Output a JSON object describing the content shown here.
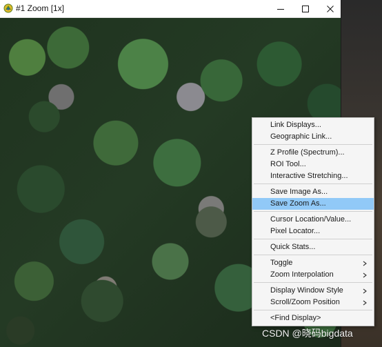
{
  "window": {
    "title": "#1 Zoom [1x]",
    "icons": {
      "app": "app-icon",
      "minimize": "minimize-icon",
      "maximize": "maximize-icon",
      "close": "close-icon"
    }
  },
  "image": {
    "description_role": "aerial-forest-canopy"
  },
  "context_menu": {
    "items": [
      {
        "label": "Link Displays...",
        "has_submenu": false
      },
      {
        "label": "Geographic Link...",
        "has_submenu": false
      },
      {
        "separator": true
      },
      {
        "label": "Z Profile (Spectrum)...",
        "has_submenu": false
      },
      {
        "label": "ROI Tool...",
        "has_submenu": false
      },
      {
        "label": "Interactive Stretching...",
        "has_submenu": false
      },
      {
        "separator": true
      },
      {
        "label": "Save Image As...",
        "has_submenu": false
      },
      {
        "label": "Save Zoom As...",
        "has_submenu": false,
        "highlighted": true
      },
      {
        "separator": true
      },
      {
        "label": "Cursor Location/Value...",
        "has_submenu": false
      },
      {
        "label": "Pixel Locator...",
        "has_submenu": false
      },
      {
        "separator": true
      },
      {
        "label": "Quick Stats...",
        "has_submenu": false
      },
      {
        "separator": true
      },
      {
        "label": "Toggle",
        "has_submenu": true
      },
      {
        "label": "Zoom Interpolation",
        "has_submenu": true
      },
      {
        "separator": true
      },
      {
        "label": "Display Window Style",
        "has_submenu": true
      },
      {
        "label": "Scroll/Zoom Position",
        "has_submenu": true
      },
      {
        "separator": true
      },
      {
        "label": "<Find Display>",
        "has_submenu": false
      }
    ],
    "colors": {
      "highlight": "#91c9f7",
      "background": "#f5f5f5"
    }
  },
  "watermark": {
    "text": "CSDN @晓码bigdata"
  }
}
